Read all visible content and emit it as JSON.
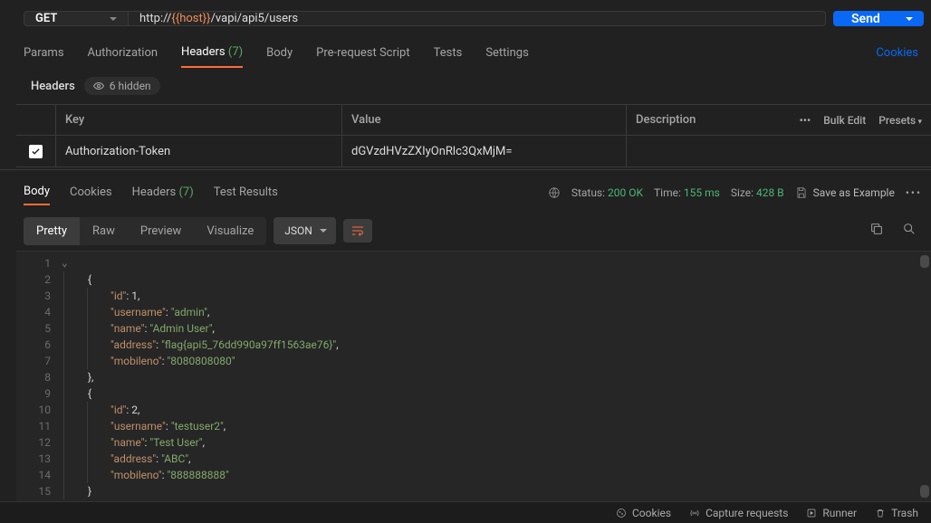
{
  "request": {
    "method": "GET",
    "url_prefix": "http://",
    "url_var": "{{host}}",
    "url_suffix": "/vapi/api5/users",
    "send_label": "Send"
  },
  "req_tabs": {
    "params": "Params",
    "auth": "Authorization",
    "headers": "Headers",
    "headers_count": "(7)",
    "body": "Body",
    "prereq": "Pre-request Script",
    "tests": "Tests",
    "settings": "Settings",
    "cookies": "Cookies"
  },
  "headers_section": {
    "title": "Headers",
    "hidden_pill": "6 hidden",
    "col_key": "Key",
    "col_val": "Value",
    "col_desc": "Description",
    "more": "•••",
    "bulk_edit": "Bulk Edit",
    "presets": "Presets",
    "row_key": "Authorization-Token",
    "row_val": "dGVzdHVzZXIyOnRlc3QxMjM="
  },
  "resp_tabs": {
    "body": "Body",
    "cookies": "Cookies",
    "headers": "Headers",
    "headers_count": "(7)",
    "test_results": "Test Results"
  },
  "resp_meta": {
    "status_label": "Status:",
    "status_val": "200 OK",
    "time_label": "Time:",
    "time_val": "155 ms",
    "size_label": "Size:",
    "size_val": "428 B",
    "save_example": "Save as Example",
    "dots": "•••"
  },
  "resp_toolbar": {
    "pretty": "Pretty",
    "raw": "Raw",
    "preview": "Preview",
    "visualize": "Visualize",
    "format": "JSON"
  },
  "code": {
    "lines": 15,
    "body": [
      {
        "ind": 1,
        "t": [
          {
            "c": "p",
            "v": "{"
          }
        ]
      },
      {
        "ind": 2,
        "t": [
          {
            "c": "k",
            "v": "\"id\""
          },
          {
            "c": "p",
            "v": ": "
          },
          {
            "c": "n",
            "v": "1"
          },
          {
            "c": "p",
            "v": ","
          }
        ]
      },
      {
        "ind": 2,
        "t": [
          {
            "c": "k",
            "v": "\"username\""
          },
          {
            "c": "p",
            "v": ": "
          },
          {
            "c": "s",
            "v": "\"admin\""
          },
          {
            "c": "p",
            "v": ","
          }
        ]
      },
      {
        "ind": 2,
        "t": [
          {
            "c": "k",
            "v": "\"name\""
          },
          {
            "c": "p",
            "v": ": "
          },
          {
            "c": "s",
            "v": "\"Admin User\""
          },
          {
            "c": "p",
            "v": ","
          }
        ]
      },
      {
        "ind": 2,
        "t": [
          {
            "c": "k",
            "v": "\"address\""
          },
          {
            "c": "p",
            "v": ": "
          },
          {
            "c": "s",
            "v": "\"flag{api5_76dd990a97ff1563ae76}\""
          },
          {
            "c": "p",
            "v": ","
          }
        ]
      },
      {
        "ind": 2,
        "t": [
          {
            "c": "k",
            "v": "\"mobileno\""
          },
          {
            "c": "p",
            "v": ": "
          },
          {
            "c": "s",
            "v": "\"8080808080\""
          }
        ]
      },
      {
        "ind": 1,
        "t": [
          {
            "c": "p",
            "v": "},"
          }
        ]
      },
      {
        "ind": 1,
        "t": [
          {
            "c": "p",
            "v": "{"
          }
        ]
      },
      {
        "ind": 2,
        "t": [
          {
            "c": "k",
            "v": "\"id\""
          },
          {
            "c": "p",
            "v": ": "
          },
          {
            "c": "n",
            "v": "2"
          },
          {
            "c": "p",
            "v": ","
          }
        ]
      },
      {
        "ind": 2,
        "t": [
          {
            "c": "k",
            "v": "\"username\""
          },
          {
            "c": "p",
            "v": ": "
          },
          {
            "c": "s",
            "v": "\"testuser2\""
          },
          {
            "c": "p",
            "v": ","
          }
        ]
      },
      {
        "ind": 2,
        "t": [
          {
            "c": "k",
            "v": "\"name\""
          },
          {
            "c": "p",
            "v": ": "
          },
          {
            "c": "s",
            "v": "\"Test User\""
          },
          {
            "c": "p",
            "v": ","
          }
        ]
      },
      {
        "ind": 2,
        "t": [
          {
            "c": "k",
            "v": "\"address\""
          },
          {
            "c": "p",
            "v": ": "
          },
          {
            "c": "s",
            "v": "\"ABC\""
          },
          {
            "c": "p",
            "v": ","
          }
        ]
      },
      {
        "ind": 2,
        "t": [
          {
            "c": "k",
            "v": "\"mobileno\""
          },
          {
            "c": "p",
            "v": ": "
          },
          {
            "c": "s",
            "v": "\"888888888\""
          }
        ]
      },
      {
        "ind": 1,
        "t": [
          {
            "c": "p",
            "v": "}"
          }
        ]
      }
    ]
  },
  "footer": {
    "cookies": "Cookies",
    "capture": "Capture requests",
    "runner": "Runner",
    "trash": "Trash"
  }
}
